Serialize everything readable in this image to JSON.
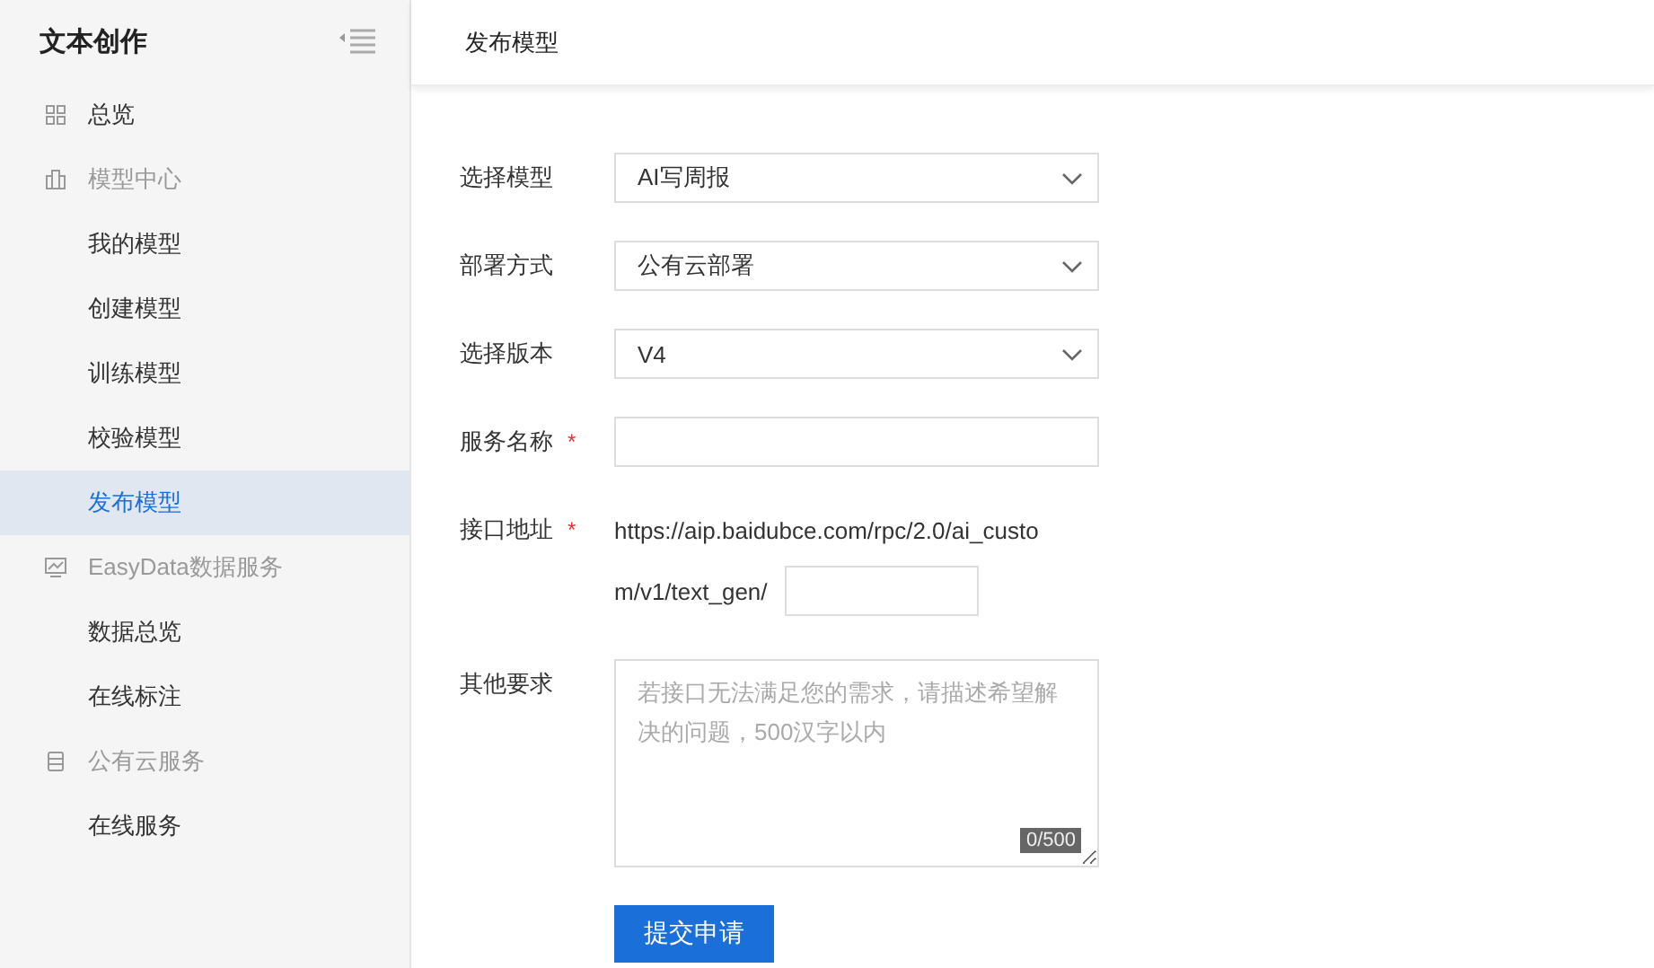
{
  "sidebar": {
    "title": "文本创作",
    "items": [
      {
        "kind": "link",
        "label": "总览",
        "selected": false
      },
      {
        "kind": "group",
        "label": "模型中心",
        "children": [
          {
            "label": "我的模型",
            "selected": false
          },
          {
            "label": "创建模型",
            "selected": false
          },
          {
            "label": "训练模型",
            "selected": false
          },
          {
            "label": "校验模型",
            "selected": false
          },
          {
            "label": "发布模型",
            "selected": true
          }
        ]
      },
      {
        "kind": "group",
        "label": "EasyData数据服务",
        "children": [
          {
            "label": "数据总览",
            "selected": false
          },
          {
            "label": "在线标注",
            "selected": false
          }
        ]
      },
      {
        "kind": "group",
        "label": "公有云服务",
        "children": [
          {
            "label": "在线服务",
            "selected": false
          }
        ]
      }
    ]
  },
  "header": {
    "title": "发布模型"
  },
  "form": {
    "fields": [
      {
        "kind": "select",
        "label": "选择模型",
        "value": "AI写周报"
      },
      {
        "kind": "select",
        "label": "部署方式",
        "value": "公有云部署"
      },
      {
        "kind": "select",
        "label": "选择版本",
        "value": "V4"
      },
      {
        "kind": "text",
        "label": "服务名称",
        "required_mark": "*"
      },
      {
        "kind": "url",
        "label": "接口地址",
        "required_mark": "*",
        "prefix_lines": [
          "https://aip.baidubce.com/rpc/2.0/ai_custo",
          "m/v1/text_gen/"
        ]
      },
      {
        "kind": "textarea",
        "label": "其他要求",
        "placeholder": "若接口无法满足您的需求，请描述希望解决的问题，500汉字以内",
        "counter": "0/500"
      }
    ],
    "submit": "提交申请"
  }
}
